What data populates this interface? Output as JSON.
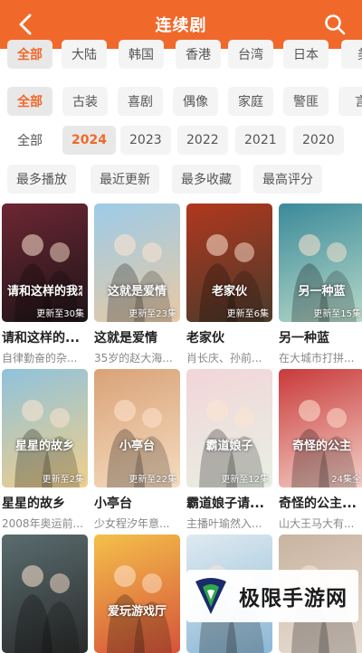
{
  "header": {
    "title": "连续剧",
    "back_icon": "chevron-left-icon",
    "search_icon": "search-icon"
  },
  "filters": {
    "regions": [
      "全部",
      "大陆",
      "韩国",
      "香港",
      "台湾",
      "日本",
      "美"
    ],
    "genres": [
      "全部",
      "古装",
      "喜剧",
      "偶像",
      "家庭",
      "警匪",
      "言"
    ],
    "years": [
      "全部",
      "2024",
      "2023",
      "2022",
      "2021",
      "2020"
    ],
    "sorts": [
      "最多播放",
      "最近更新",
      "最多收藏",
      "最高评分"
    ]
  },
  "accent_color": "#f0692b",
  "cards": [
    {
      "title": "请和这样的...",
      "subtitle": "自律勤奋的杂...",
      "badge": "更新至30集",
      "poster_text": "请和这样的我恋爱吧",
      "colors": [
        "#6d2733",
        "#1d1418"
      ]
    },
    {
      "title": "这就是爱情",
      "subtitle": "35岁的赵大海...",
      "badge": "更新至23集",
      "poster_text": "这就是爱情",
      "colors": [
        "#9ccbe9",
        "#e8c9a4"
      ]
    },
    {
      "title": "老家伙",
      "subtitle": "肖长庆、孙前...",
      "badge": "更新至6集",
      "poster_text": "老家伙",
      "colors": [
        "#b1381f",
        "#4a3a2a"
      ]
    },
    {
      "title": "另一种蓝",
      "subtitle": "在大城市打拼...",
      "badge": "更新至15集",
      "poster_text": "另一种蓝",
      "colors": [
        "#3a8a9a",
        "#b8d9c8"
      ]
    },
    {
      "title": "星星的故乡",
      "subtitle": "2008年奥运前...",
      "badge": "更新至2集",
      "poster_text": "星星的故乡",
      "colors": [
        "#8fc2dc",
        "#f1cf8a"
      ]
    },
    {
      "title": "小亭台",
      "subtitle": "少女程汐年意...",
      "badge": "更新至22集",
      "poster_text": "小亭台",
      "colors": [
        "#d9a277",
        "#f5dcc0"
      ]
    },
    {
      "title": "霸道娘子请...",
      "subtitle": "主播叶瑜然入...",
      "badge": "更新至12集",
      "poster_text": "霸道娘子",
      "colors": [
        "#f2d5d8",
        "#e7f0e3"
      ]
    },
    {
      "title": "奇怪的公主...",
      "subtitle": "山大王马大有...",
      "badge": "24集全",
      "poster_text": "奇怪的公主",
      "colors": [
        "#c83a3a",
        "#f4d0c8"
      ]
    },
    {
      "title": "",
      "subtitle": "",
      "badge": "",
      "poster_text": "",
      "colors": [
        "#5a6d6f",
        "#2b2b2b"
      ]
    },
    {
      "title": "",
      "subtitle": "",
      "badge": "",
      "poster_text": "爱玩游戏厅",
      "colors": [
        "#f4c04a",
        "#d6533a"
      ]
    },
    {
      "title": "",
      "subtitle": "",
      "badge": "",
      "poster_text": "",
      "colors": [
        "#dfeaf0",
        "#8bb8d6"
      ]
    },
    {
      "title": "",
      "subtitle": "",
      "badge": "",
      "poster_text": "",
      "colors": [
        "#c9b3a0",
        "#e9ded4"
      ]
    }
  ],
  "watermark": {
    "text": "极限手游网"
  }
}
